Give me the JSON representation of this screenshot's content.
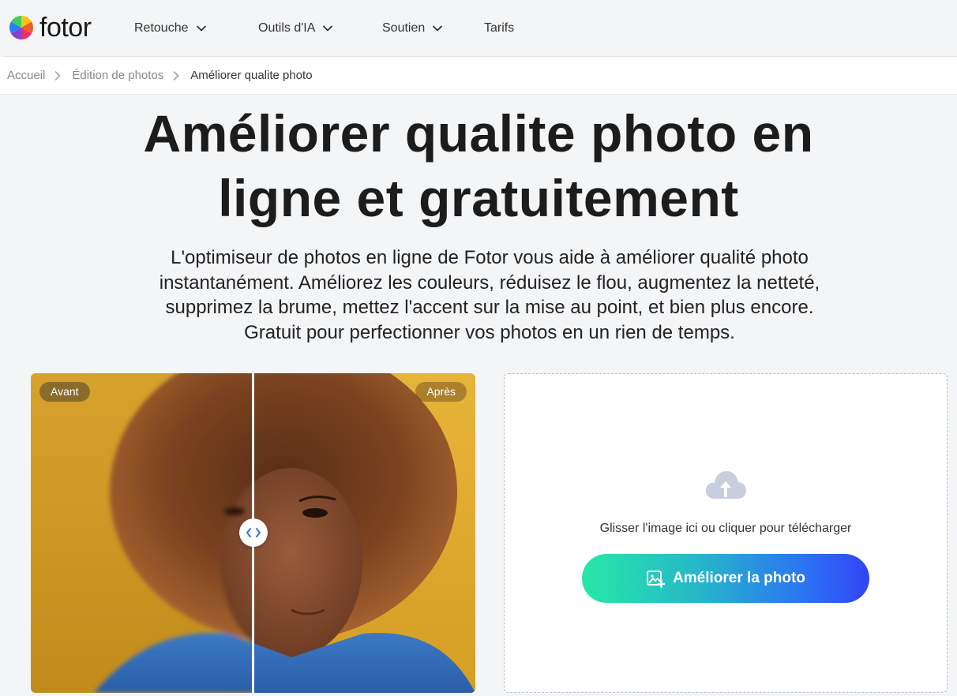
{
  "brand": {
    "name": "fotor"
  },
  "nav": [
    {
      "label": "Retouche",
      "has_dropdown": true
    },
    {
      "label": "Outils d'IA",
      "has_dropdown": true
    },
    {
      "label": "Soutien",
      "has_dropdown": true
    },
    {
      "label": "Tarifs",
      "has_dropdown": false
    }
  ],
  "breadcrumb": [
    {
      "label": "Accueil"
    },
    {
      "label": "Édition de photos"
    },
    {
      "label": "Améliorer qualite photo"
    }
  ],
  "hero": {
    "title_line1": "Améliorer qualite photo en",
    "title_line2": "ligne et gratuitement",
    "subtitle_line1": "L'optimiseur de photos en ligne de Fotor vous aide à améliorer qualité photo",
    "subtitle_line2": "instantanément. Améliorez les couleurs, réduisez le flou, augmentez la netteté,",
    "subtitle_line3": "supprimez la brume, mettez l'accent sur la mise au point, et bien plus encore.",
    "subtitle_line4": "Gratuit pour perfectionner vos photos en un rien de temps."
  },
  "compare": {
    "before_label": "Avant",
    "after_label": "Après",
    "split_fraction": 0.5
  },
  "upload": {
    "hint": "Glisser l'image ici ou cliquer pour télécharger",
    "button_label": "Améliorer la photo",
    "icon": "cloud-upload-icon"
  },
  "colors": {
    "page_bg": "#f4f5f7",
    "cta_gradient_start": "#27e8a5",
    "cta_gradient_end": "#3344f5",
    "upload_icon": "#c9cede"
  }
}
